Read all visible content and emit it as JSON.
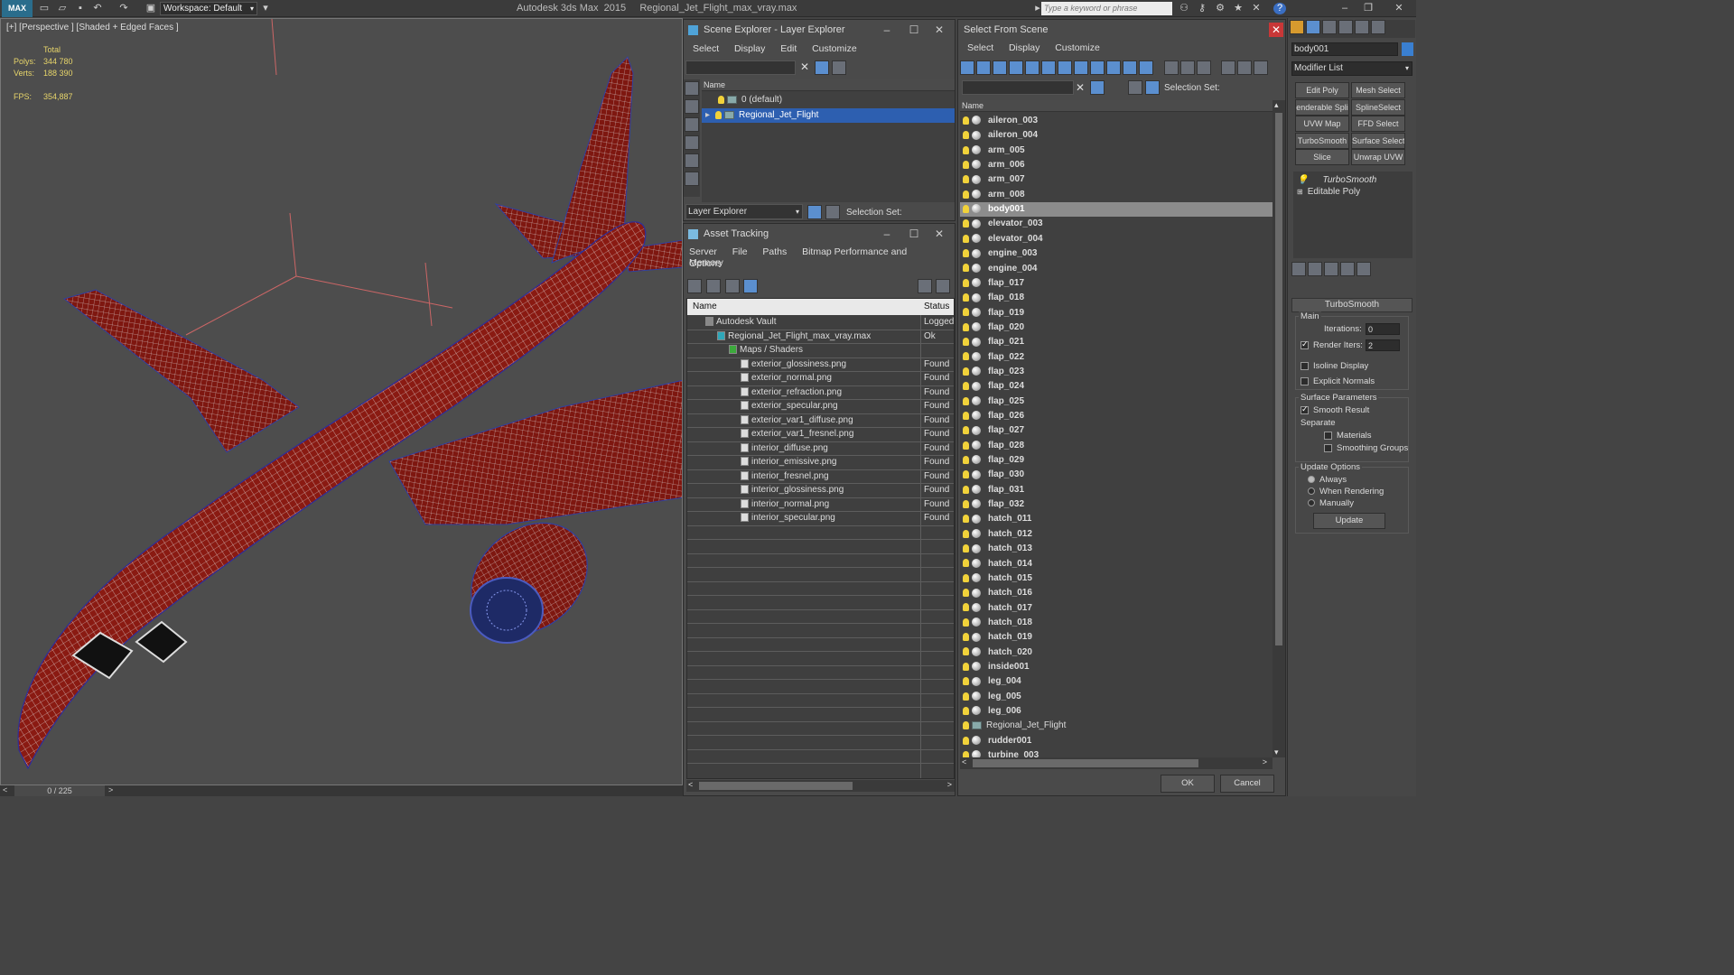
{
  "app": {
    "logo": "MAX",
    "workspace": "Workspace: Default",
    "title": "Autodesk 3ds Max  2015     Regional_Jet_Flight_max_vray.max",
    "search_placeholder": "Type a keyword or phrase"
  },
  "viewport": {
    "label": "[+] [Perspective ] [Shaded + Edged Faces ]",
    "total_label": "Total",
    "polys_label": "Polys:",
    "polys": "344 780",
    "verts_label": "Verts:",
    "verts": "188 390",
    "fps_label": "FPS:",
    "fps": "354,887",
    "frame": "0 / 225"
  },
  "layer_explorer": {
    "title": "Scene Explorer - Layer Explorer",
    "menu": [
      "Select",
      "Display",
      "Edit",
      "Customize"
    ],
    "col_name": "Name",
    "rows": [
      "0 (default)",
      "Regional_Jet_Flight"
    ],
    "footer_dropdown": "Layer Explorer",
    "selection_set": "Selection Set:"
  },
  "asset_tracking": {
    "title": "Asset Tracking",
    "menu": [
      "Server",
      "File",
      "Paths",
      "Bitmap Performance and Memory"
    ],
    "menu2": "Options",
    "col_name": "Name",
    "col_status": "Status",
    "rows": [
      {
        "name": "Autodesk Vault",
        "status": "Logged",
        "indent": 0
      },
      {
        "name": "Regional_Jet_Flight_max_vray.max",
        "status": "Ok",
        "indent": 1
      },
      {
        "name": "Maps / Shaders",
        "status": "",
        "indent": 2
      },
      {
        "name": "exterior_glossiness.png",
        "status": "Found",
        "indent": 3
      },
      {
        "name": "exterior_normal.png",
        "status": "Found",
        "indent": 3
      },
      {
        "name": "exterior_refraction.png",
        "status": "Found",
        "indent": 3
      },
      {
        "name": "exterior_specular.png",
        "status": "Found",
        "indent": 3
      },
      {
        "name": "exterior_var1_diffuse.png",
        "status": "Found",
        "indent": 3
      },
      {
        "name": "exterior_var1_fresnel.png",
        "status": "Found",
        "indent": 3
      },
      {
        "name": "interior_diffuse.png",
        "status": "Found",
        "indent": 3
      },
      {
        "name": "interior_emissive.png",
        "status": "Found",
        "indent": 3
      },
      {
        "name": "interior_fresnel.png",
        "status": "Found",
        "indent": 3
      },
      {
        "name": "interior_glossiness.png",
        "status": "Found",
        "indent": 3
      },
      {
        "name": "interior_normal.png",
        "status": "Found",
        "indent": 3
      },
      {
        "name": "interior_specular.png",
        "status": "Found",
        "indent": 3
      }
    ]
  },
  "select_from_scene": {
    "title": "Select From Scene",
    "menu": [
      "Select",
      "Display",
      "Customize"
    ],
    "selection_set": "Selection Set:",
    "col_name": "Name",
    "items": [
      "aileron_003",
      "aileron_004",
      "arm_005",
      "arm_006",
      "arm_007",
      "arm_008",
      "body001",
      "elevator_003",
      "elevator_004",
      "engine_003",
      "engine_004",
      "flap_017",
      "flap_018",
      "flap_019",
      "flap_020",
      "flap_021",
      "flap_022",
      "flap_023",
      "flap_024",
      "flap_025",
      "flap_026",
      "flap_027",
      "flap_028",
      "flap_029",
      "flap_030",
      "flap_031",
      "flap_032",
      "hatch_011",
      "hatch_012",
      "hatch_013",
      "hatch_014",
      "hatch_015",
      "hatch_016",
      "hatch_017",
      "hatch_018",
      "hatch_019",
      "hatch_020",
      "inside001",
      "leg_004",
      "leg_005",
      "leg_006",
      "Regional_Jet_Flight",
      "rudder001",
      "turbine_003"
    ],
    "selected": "body001",
    "ok": "OK",
    "cancel": "Cancel"
  },
  "command_panel": {
    "object_name": "body001",
    "modifier_list": "Modifier List",
    "buttons": [
      "Edit Poly",
      "Mesh Select",
      "enderable Spli",
      "SplineSelect",
      "UVW Map",
      "FFD Select",
      "TurboSmooth",
      "Surface Select",
      "Slice",
      "Unwrap UVW"
    ],
    "stack": [
      "TurboSmooth",
      "Editable Poly"
    ],
    "rollout_title": "TurboSmooth",
    "main_label": "Main",
    "iterations_label": "Iterations:",
    "iterations": "0",
    "render_iters_label": "Render Iters:",
    "render_iters": "2",
    "isoline": "Isoline Display",
    "explicit": "Explicit Normals",
    "surface_params": "Surface Parameters",
    "smooth_result": "Smooth Result",
    "separate": "Separate",
    "materials": "Materials",
    "smoothing_groups": "Smoothing Groups",
    "update_options": "Update Options",
    "always": "Always",
    "when_rendering": "When Rendering",
    "manually": "Manually",
    "update": "Update"
  }
}
